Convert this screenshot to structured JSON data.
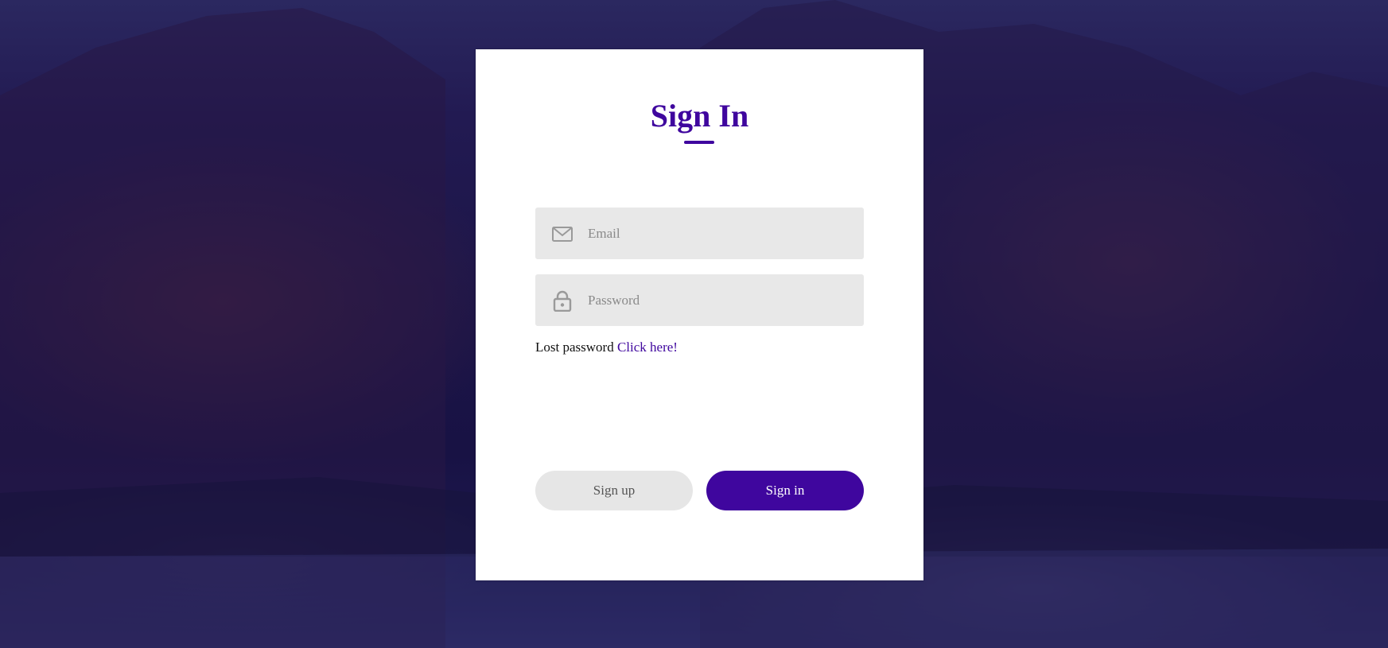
{
  "title": "Sign In",
  "fields": {
    "email": {
      "placeholder": "Email",
      "icon": "mail-icon",
      "value": ""
    },
    "password": {
      "placeholder": "Password",
      "icon": "lock-icon",
      "value": ""
    }
  },
  "lost_password": {
    "text": "Lost password",
    "link": "Click here!"
  },
  "buttons": {
    "signup": "Sign up",
    "signin": "Sign in"
  },
  "colors": {
    "accent": "#3f069e",
    "field_bg": "#e8e8e8",
    "card_bg": "#ffffff",
    "background_overlay": "#1c1548"
  }
}
